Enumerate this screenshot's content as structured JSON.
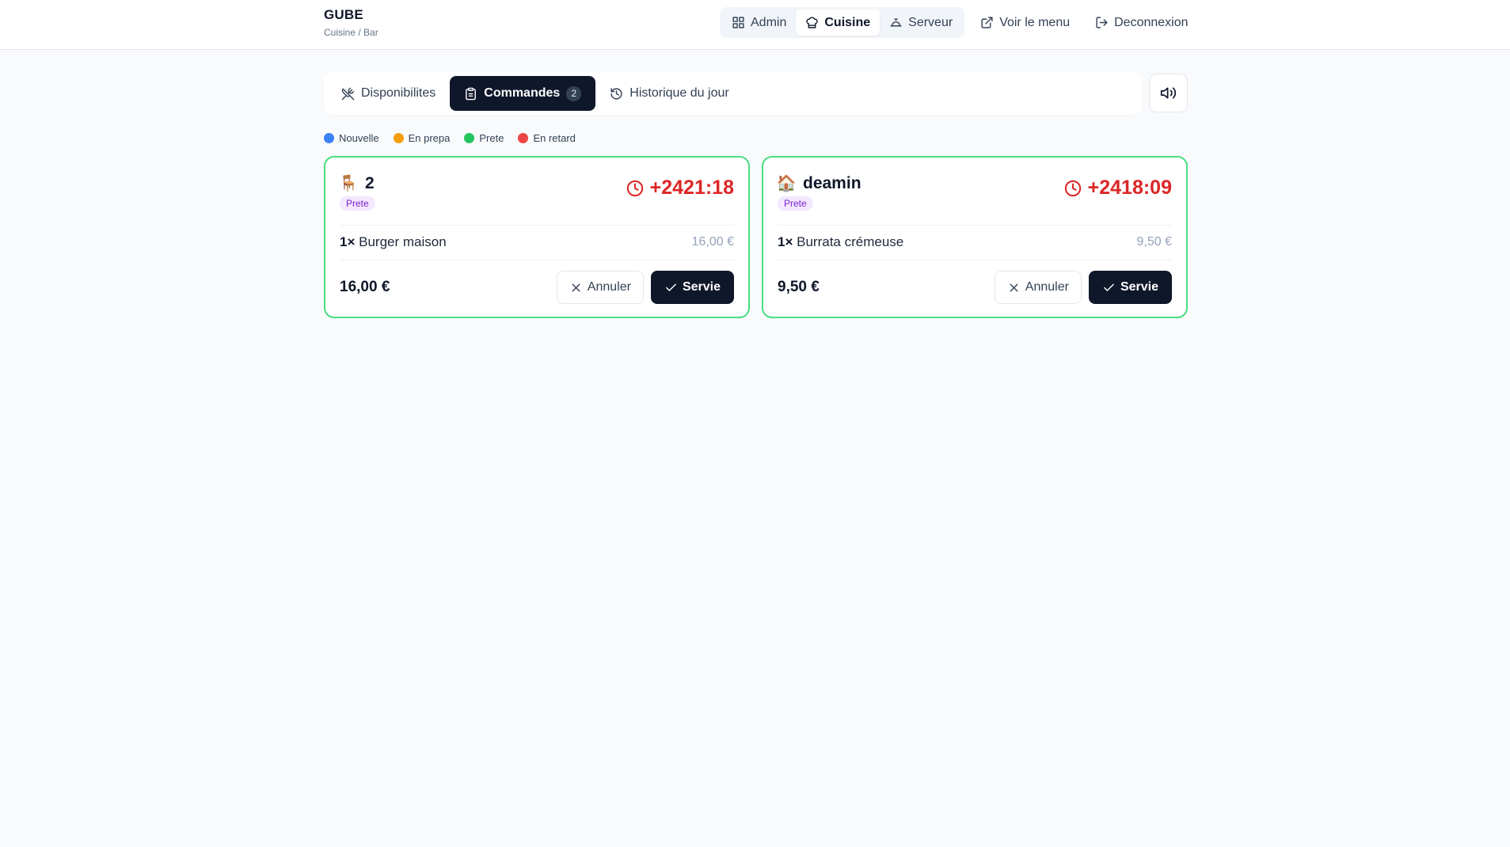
{
  "app": {
    "name": "GUBE",
    "subtitle": "Cuisine / Bar"
  },
  "nav": {
    "views": [
      {
        "label": "Admin",
        "icon": "grid-icon",
        "active": false
      },
      {
        "label": "Cuisine",
        "icon": "chef-hat-icon",
        "active": true
      },
      {
        "label": "Serveur",
        "icon": "cloche-icon",
        "active": false
      }
    ],
    "view_menu": "Voir le menu",
    "logout": "Deconnexion"
  },
  "tabs": [
    {
      "label": "Disponibilites",
      "icon": "utensils-crossed-icon",
      "active": false
    },
    {
      "label": "Commandes",
      "icon": "clipboard-icon",
      "active": true,
      "badge": "2"
    },
    {
      "label": "Historique du jour",
      "icon": "history-icon",
      "active": false
    }
  ],
  "sound_icon": "volume-icon",
  "legend": [
    {
      "label": "Nouvelle",
      "color": "#3b82f6"
    },
    {
      "label": "En prepa",
      "color": "#f59e0b"
    },
    {
      "label": "Prete",
      "color": "#22c55e"
    },
    {
      "label": "En retard",
      "color": "#ef4444"
    }
  ],
  "orders": [
    {
      "emoji": "🪑",
      "name": "2",
      "status": "Prete",
      "timer": "+2421:18",
      "items": [
        {
          "qty": "1×",
          "name": "Burger maison",
          "price": "16,00 €"
        }
      ],
      "total": "16,00 €",
      "cancel_label": "Annuler",
      "served_label": "Servie"
    },
    {
      "emoji": "🏠",
      "name": "deamin",
      "status": "Prete",
      "timer": "+2418:09",
      "items": [
        {
          "qty": "1×",
          "name": "Burrata crémeuse",
          "price": "9,50 €"
        }
      ],
      "total": "9,50 €",
      "cancel_label": "Annuler",
      "served_label": "Servie"
    }
  ],
  "colors": {
    "primary": "#0f172a",
    "card_border": "#4ade80",
    "timer_late": "#dc2626",
    "badge_bg": "#f3e8ff",
    "badge_text": "#7e22ce"
  }
}
